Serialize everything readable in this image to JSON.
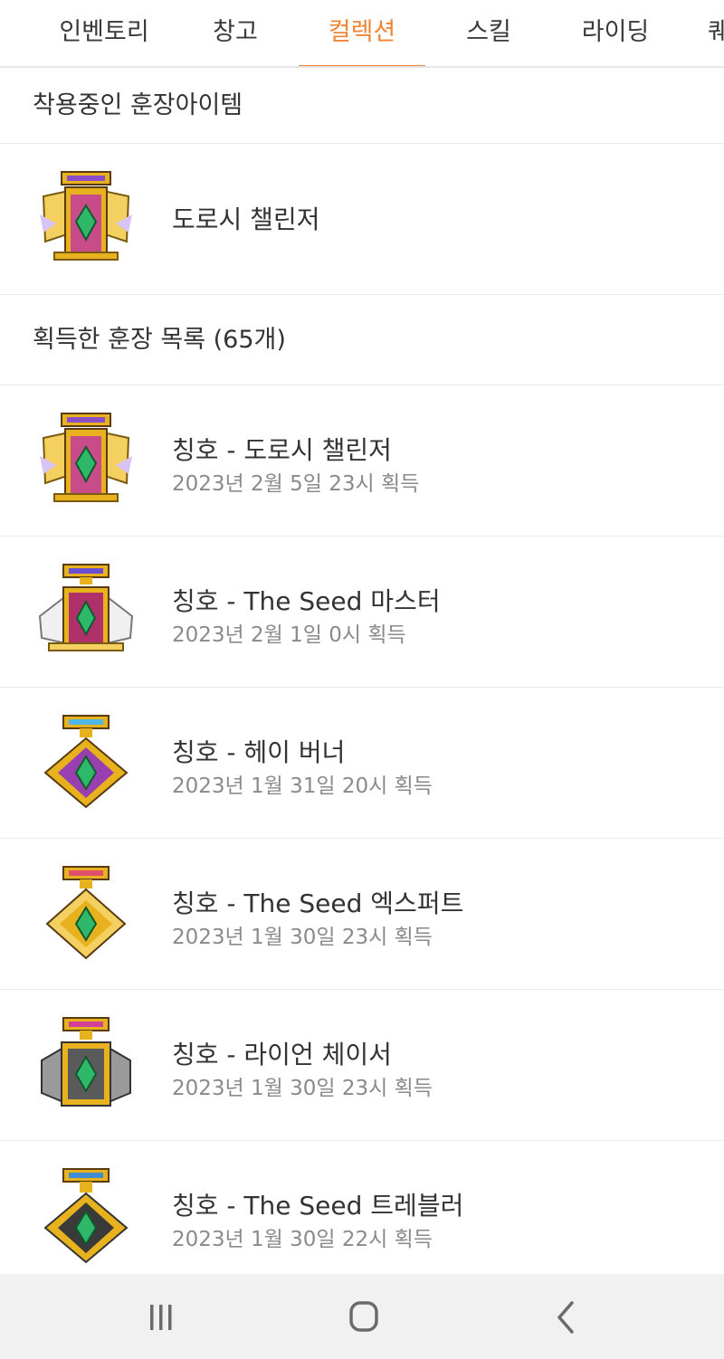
{
  "tabs": [
    {
      "label": "인벤토리",
      "active": false
    },
    {
      "label": "창고",
      "active": false
    },
    {
      "label": "컬렉션",
      "active": true
    },
    {
      "label": "스킬",
      "active": false
    },
    {
      "label": "라이딩",
      "active": false
    },
    {
      "label": "퀘",
      "active": false
    }
  ],
  "equipped": {
    "header": "착용중인 훈장아이템",
    "item": {
      "name": "도로시 챌린저",
      "medal_icon": "dorothy-challenger-medal-icon"
    }
  },
  "acquired": {
    "header": "획득한 훈장 목록 (65개)",
    "items": [
      {
        "title": "칭호 - 도로시 챌린저",
        "date": "2023년 2월 5일 23시  획득",
        "medal_icon": "dorothy-challenger-medal-icon"
      },
      {
        "title": "칭호 - The Seed 마스터",
        "date": "2023년 2월 1일 0시  획득",
        "medal_icon": "seed-master-medal-icon"
      },
      {
        "title": "칭호 - 헤이 버너",
        "date": "2023년 1월 31일 20시  획득",
        "medal_icon": "hey-burner-medal-icon"
      },
      {
        "title": "칭호 - The Seed 엑스퍼트",
        "date": "2023년 1월 30일 23시  획득",
        "medal_icon": "seed-expert-medal-icon"
      },
      {
        "title": "칭호 - 라이언 체이서",
        "date": "2023년 1월 30일 23시  획득",
        "medal_icon": "lion-chaser-medal-icon"
      },
      {
        "title": "칭호 - The Seed 트레블러",
        "date": "2023년 1월 30일 22시  획득",
        "medal_icon": "seed-traveler-medal-icon"
      }
    ]
  },
  "navbar": {
    "recents_icon": "recent-apps-icon",
    "home_icon": "home-icon",
    "back_icon": "back-icon"
  },
  "colors": {
    "accent": "#f08533",
    "gold": "#e8b21e",
    "emerald": "#2fb86a"
  }
}
